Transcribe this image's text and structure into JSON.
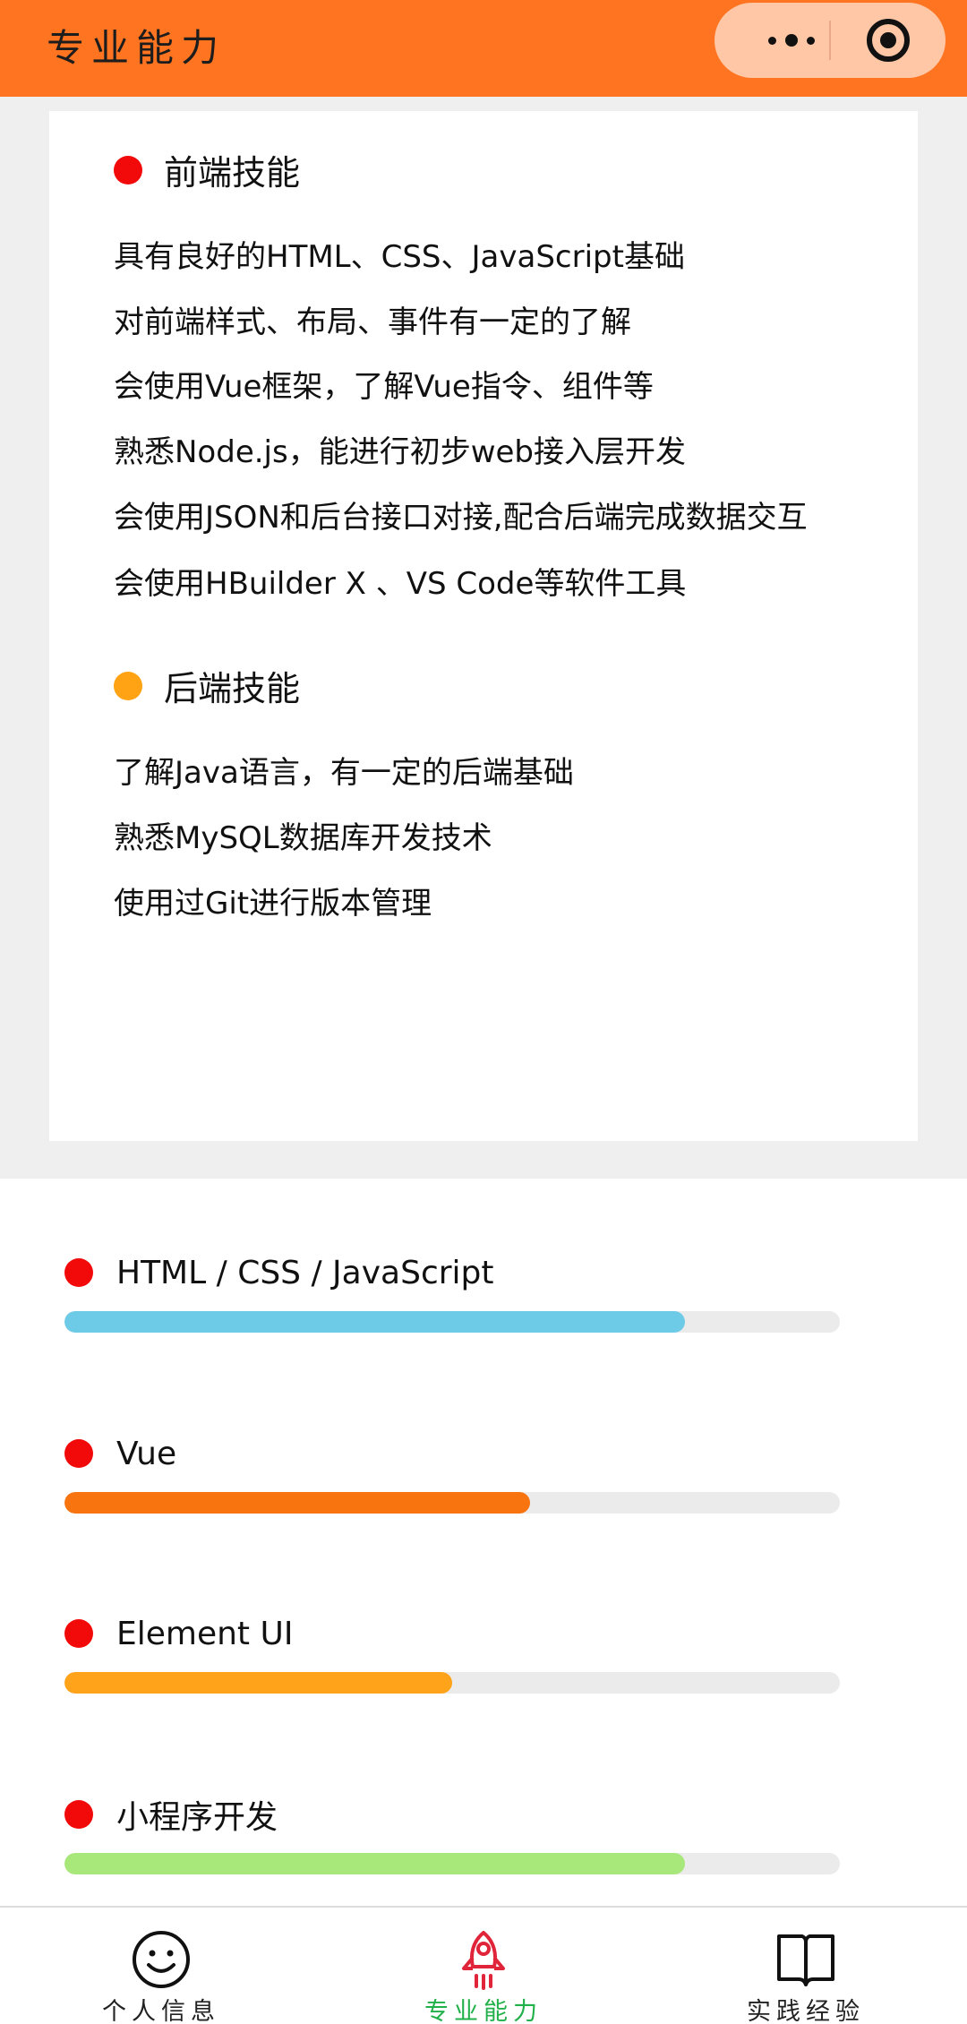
{
  "header": {
    "title": "专业能力",
    "more_icon": "more-dots-icon",
    "close_icon": "miniprogram-close-icon",
    "color": "#ff7420"
  },
  "skills": {
    "frontend": {
      "title": "前端技能",
      "dot_color": "#f20a0a",
      "items": [
        "具有良好的HTML、CSS、JavaScript基础",
        "对前端样式、布局、事件有一定的了解",
        "会使用Vue框架，了解Vue指令、组件等",
        "熟悉Node.js，能进行初步web接入层开发",
        "会使用JSON和后台接口对接,配合后端完成数据交互",
        "会使用HBuilder X 、VS Code等软件工具"
      ]
    },
    "backend": {
      "title": "后端技能",
      "dot_color": "#ffa314",
      "items": [
        "了解Java语言，有一定的后端基础",
        "熟悉MySQL数据库开发技术",
        "使用过Git进行版本管理"
      ]
    }
  },
  "proficiency": [
    {
      "label": "HTML / CSS / JavaScript",
      "percent": 80,
      "color": "#6ecbe8"
    },
    {
      "label": "Vue",
      "percent": 60,
      "color": "#f7740f"
    },
    {
      "label": "Element UI",
      "percent": 50,
      "color": "#ffa31a"
    },
    {
      "label": "小程序开发",
      "percent": 80,
      "color": "#a8e87a"
    }
  ],
  "tabbar": {
    "items": [
      {
        "label": "个人信息",
        "icon": "smiley-face-icon",
        "active": false
      },
      {
        "label": "专业能力",
        "icon": "rocket-icon",
        "active": true
      },
      {
        "label": "实践经验",
        "icon": "open-book-icon",
        "active": false
      }
    ],
    "active_color": "#22b04a"
  }
}
